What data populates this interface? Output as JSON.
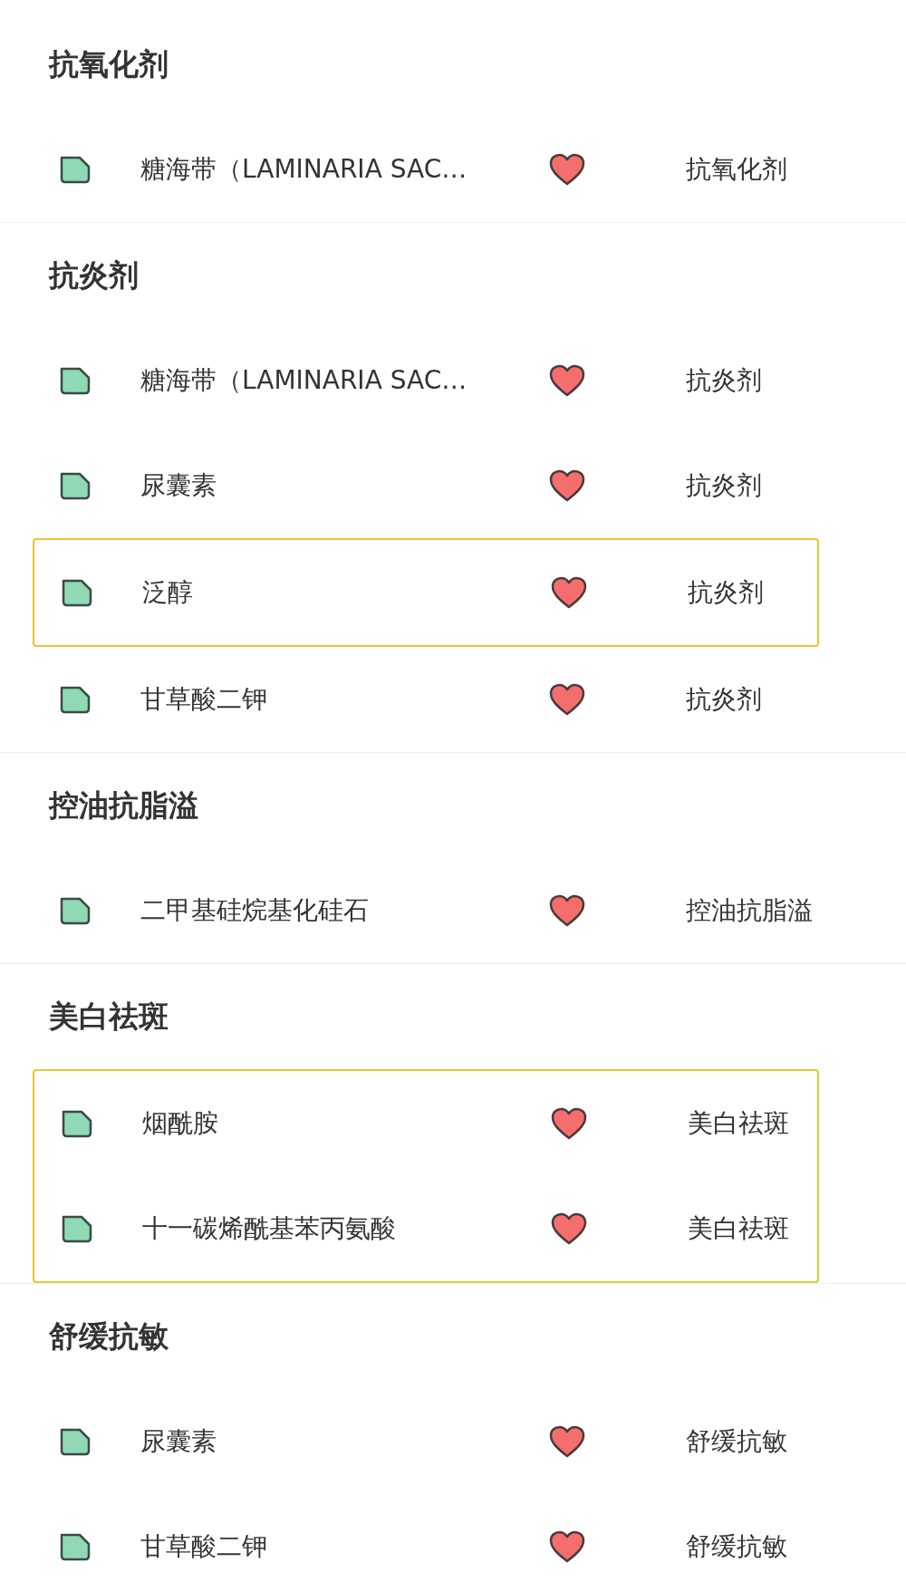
{
  "sections": [
    {
      "title": "抗氧化剂",
      "rows": [
        {
          "name": "糖海带（LAMINARIA SAC…",
          "function": "抗氧化剂",
          "favorite": true,
          "highlighted": false
        }
      ]
    },
    {
      "title": "抗炎剂",
      "rows": [
        {
          "name": "糖海带（LAMINARIA SAC…",
          "function": "抗炎剂",
          "favorite": true,
          "highlighted": false
        },
        {
          "name": "尿囊素",
          "function": "抗炎剂",
          "favorite": true,
          "highlighted": false
        },
        {
          "name": "泛醇",
          "function": "抗炎剂",
          "favorite": true,
          "highlighted": true
        },
        {
          "name": "甘草酸二钾",
          "function": "抗炎剂",
          "favorite": true,
          "highlighted": false
        }
      ]
    },
    {
      "title": "控油抗脂溢",
      "rows": [
        {
          "name": "二甲基硅烷基化硅石",
          "function": "控油抗脂溢",
          "favorite": true,
          "highlighted": false
        }
      ]
    },
    {
      "title": "美白祛斑",
      "rows": [
        {
          "name": "烟酰胺",
          "function": "美白祛斑",
          "favorite": true,
          "highlighted": true
        },
        {
          "name": "十一碳烯酰基苯丙氨酸",
          "function": "美白祛斑",
          "favorite": true,
          "highlighted": true
        }
      ]
    },
    {
      "title": "舒缓抗敏",
      "rows": [
        {
          "name": "尿囊素",
          "function": "舒缓抗敏",
          "favorite": true,
          "highlighted": false
        },
        {
          "name": "甘草酸二钾",
          "function": "舒缓抗敏",
          "favorite": true,
          "highlighted": false
        }
      ]
    }
  ]
}
